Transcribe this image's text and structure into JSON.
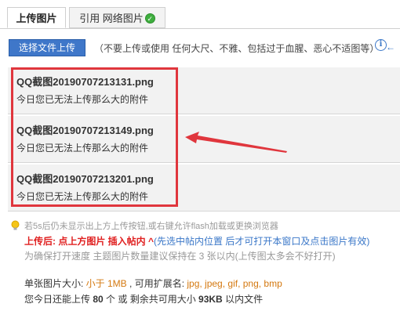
{
  "tabs": {
    "upload_label": "上传图片",
    "reference_label": "引用 网络图片"
  },
  "toolbar": {
    "upload_button": "选择文件上传",
    "hint": "（不要上传或使用 任何大尺、不雅、包括过于血腥、恶心不适图等）",
    "arrow_note": "←"
  },
  "files": [
    {
      "name": "QQ截图20190707213131.png",
      "status": "今日您已无法上传那么大的附件"
    },
    {
      "name": "QQ截图20190707213149.png",
      "status": "今日您已无法上传那么大的附件"
    },
    {
      "name": "QQ截图20190707213201.png",
      "status": "今日您已无法上传那么大的附件"
    }
  ],
  "notes": {
    "flash_tip": "若5s后仍未显示出上方上传按钮,或右键允许flash加载或更换浏览器",
    "after_upload_prefix": "上传后: 点上方图片 插入帖内",
    "after_upload_caret": " ^",
    "after_upload_suffix": "(先选中帖内位置 后才可打开本窗口及点击图片有效)",
    "speed_tip": "为确保打开速度 主题图片数量建议保持在 3 张以内(上传图太多会不好打开)"
  },
  "limits": {
    "single_prefix": "单张图片大小: ",
    "single_size": "小于 1MB",
    "ext_prefix": " , 可用扩展名: ",
    "extensions": "jpg, jpeg, gif, png, bmp",
    "today_prefix": "您今日还能上传 ",
    "count": "80",
    "today_mid": " 个 或 剩余共可用大小 ",
    "size_left": "93KB",
    "today_suffix": " 以内文件"
  },
  "colors": {
    "highlight": "#e0363d",
    "button": "#3f77c9",
    "accent_blue": "#3a77c8",
    "warning_red": "#e02020",
    "orange": "#d4780f"
  }
}
